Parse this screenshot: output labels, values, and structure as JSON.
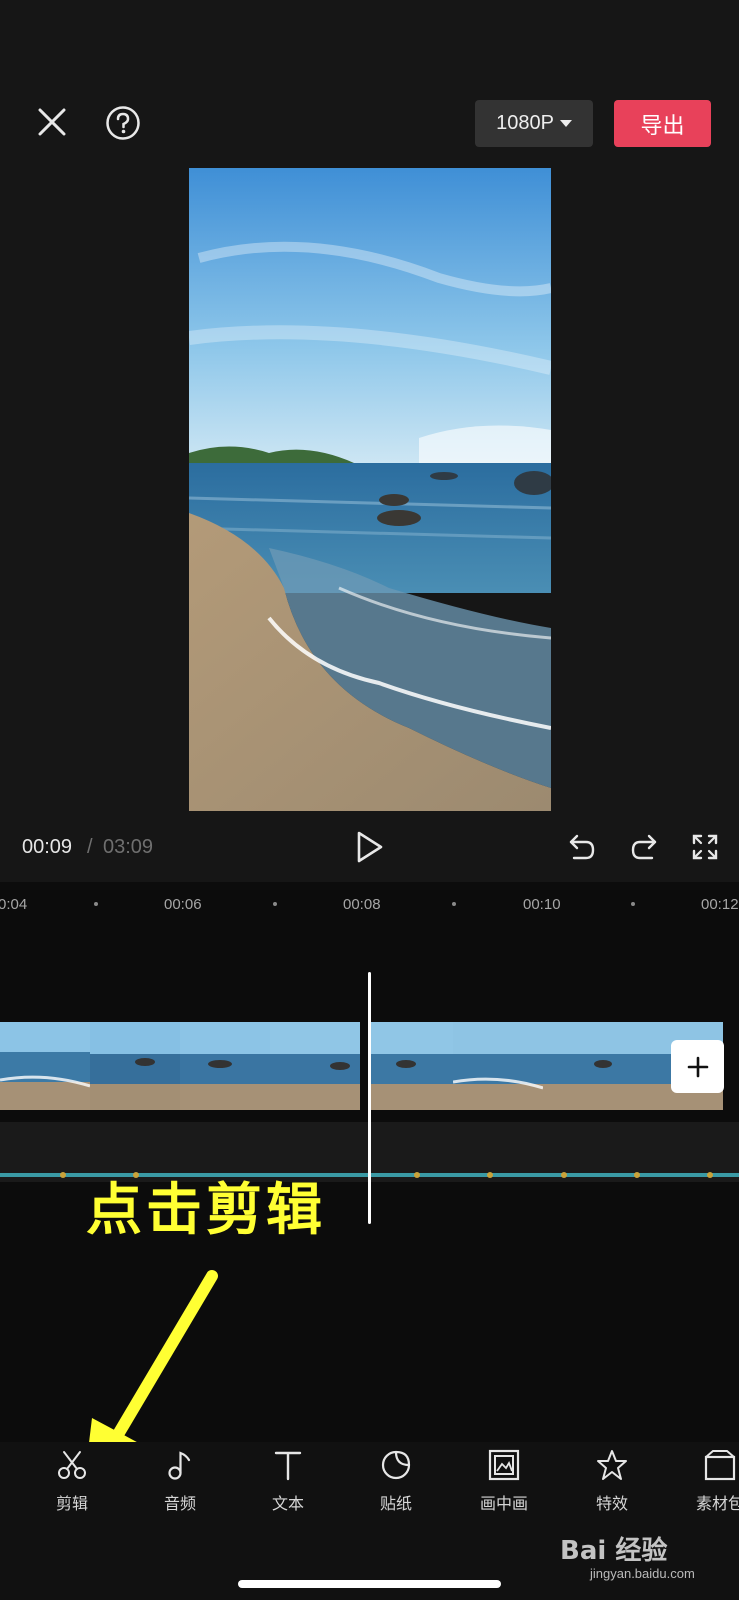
{
  "top_bar": {
    "resolution": "1080P",
    "export_label": "导出"
  },
  "playback": {
    "current_time": "00:09",
    "separator": "/",
    "total_time": "03:09"
  },
  "timeline": {
    "ruler": [
      "0:04",
      "00:06",
      "00:08",
      "00:10",
      "00:12"
    ]
  },
  "annotation": {
    "text": "点击剪辑"
  },
  "toolbar": {
    "items": [
      {
        "label": "剪辑",
        "icon": "scissors-icon"
      },
      {
        "label": "音频",
        "icon": "music-note-icon"
      },
      {
        "label": "文本",
        "icon": "text-icon"
      },
      {
        "label": "贴纸",
        "icon": "sticker-icon"
      },
      {
        "label": "画中画",
        "icon": "picture-in-picture-icon"
      },
      {
        "label": "特效",
        "icon": "effects-star-icon"
      },
      {
        "label": "素材包",
        "icon": "asset-pack-icon"
      }
    ]
  },
  "watermark": {
    "brand": "Bai 经验",
    "url": "jingyan.baidu.com"
  },
  "colors": {
    "accent": "#e8415a",
    "annotation": "#ffff33"
  }
}
